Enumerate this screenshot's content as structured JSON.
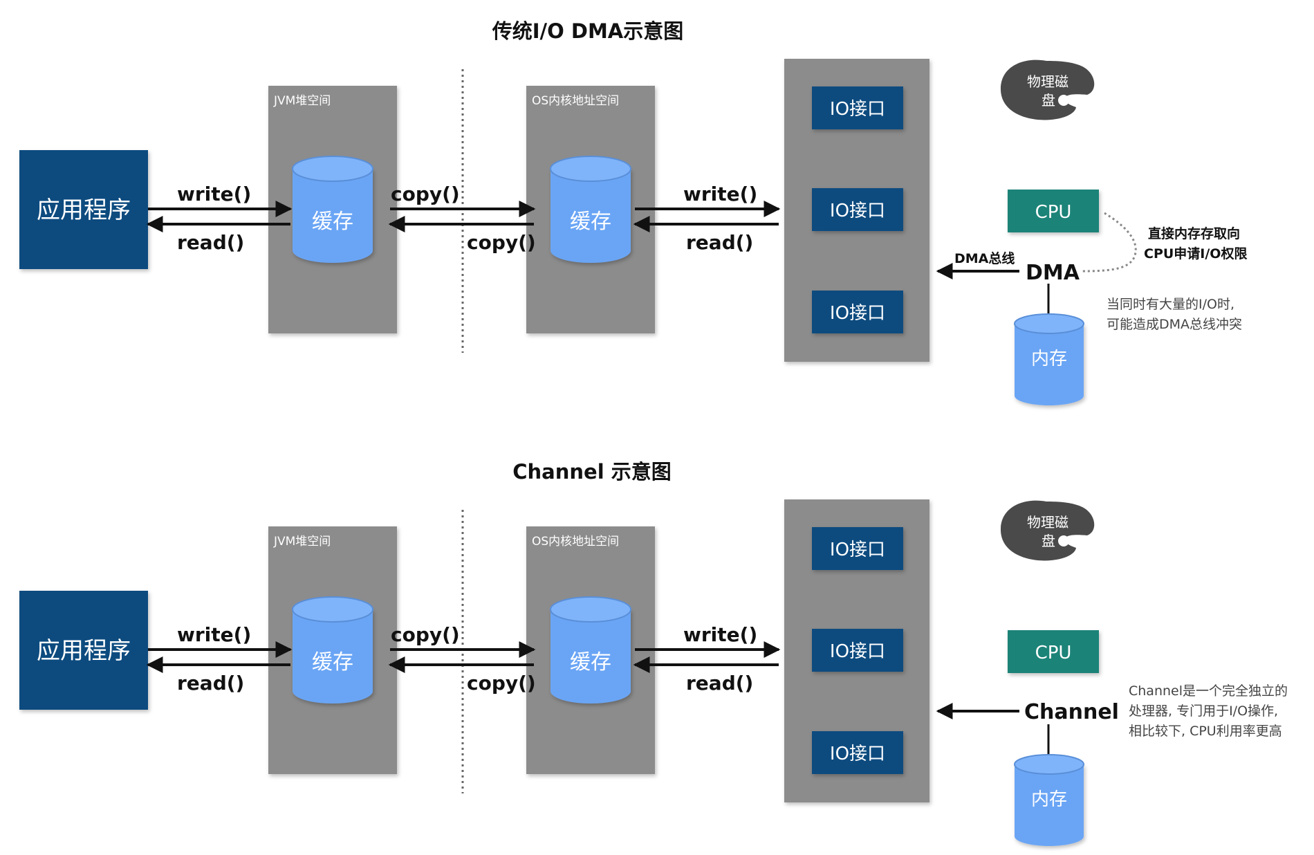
{
  "diagrams": [
    {
      "title": "传统I/O DMA示意图",
      "app": "应用程序",
      "jvm_panel": "JVM堆空间",
      "os_panel": "OS内核地址空间",
      "cache_jvm": "缓存",
      "cache_os": "缓存",
      "arrow_labels": {
        "write1": "write()",
        "read1": "read()",
        "copy_top": "copy()",
        "copy_bottom": "copy()",
        "write2": "write()",
        "read2": "read()"
      },
      "io_ports": [
        "IO接口",
        "IO接口",
        "IO接口"
      ],
      "disk": [
        "物理磁",
        "盘"
      ],
      "cpu": "CPU",
      "controller": "DMA",
      "bus_label": "DMA总线",
      "memory": "内存",
      "note_right": [
        "直接内存存取向",
        "CPU申请I/O权限"
      ],
      "note_bottom": [
        "当同时有大量的I/O时,",
        "可能造成DMA总线冲突"
      ]
    },
    {
      "title": "Channel 示意图",
      "app": "应用程序",
      "jvm_panel": "JVM堆空间",
      "os_panel": "OS内核地址空间",
      "cache_jvm": "缓存",
      "cache_os": "缓存",
      "arrow_labels": {
        "write1": "write()",
        "read1": "read()",
        "copy_top": "copy()",
        "copy_bottom": "copy()",
        "write2": "write()",
        "read2": "read()"
      },
      "io_ports": [
        "IO接口",
        "IO接口",
        "IO接口"
      ],
      "disk": [
        "物理磁",
        "盘"
      ],
      "cpu": "CPU",
      "controller": "Channel",
      "memory": "内存",
      "note_side": [
        "Channel是一个完全独立的",
        "处理器, 专门用于I/O操作,",
        "相比较下, CPU利用率更高"
      ]
    }
  ],
  "colors": {
    "app_box": "#0f4c7f",
    "panel": "#8c8c8c",
    "cylinder": "#6aa5f5",
    "cylinder_top": "#7fb4fa",
    "io_box": "#0f4c7f",
    "cpu_box": "#1b8378",
    "disk": "#4a4a4a",
    "arrow": "#111111"
  }
}
